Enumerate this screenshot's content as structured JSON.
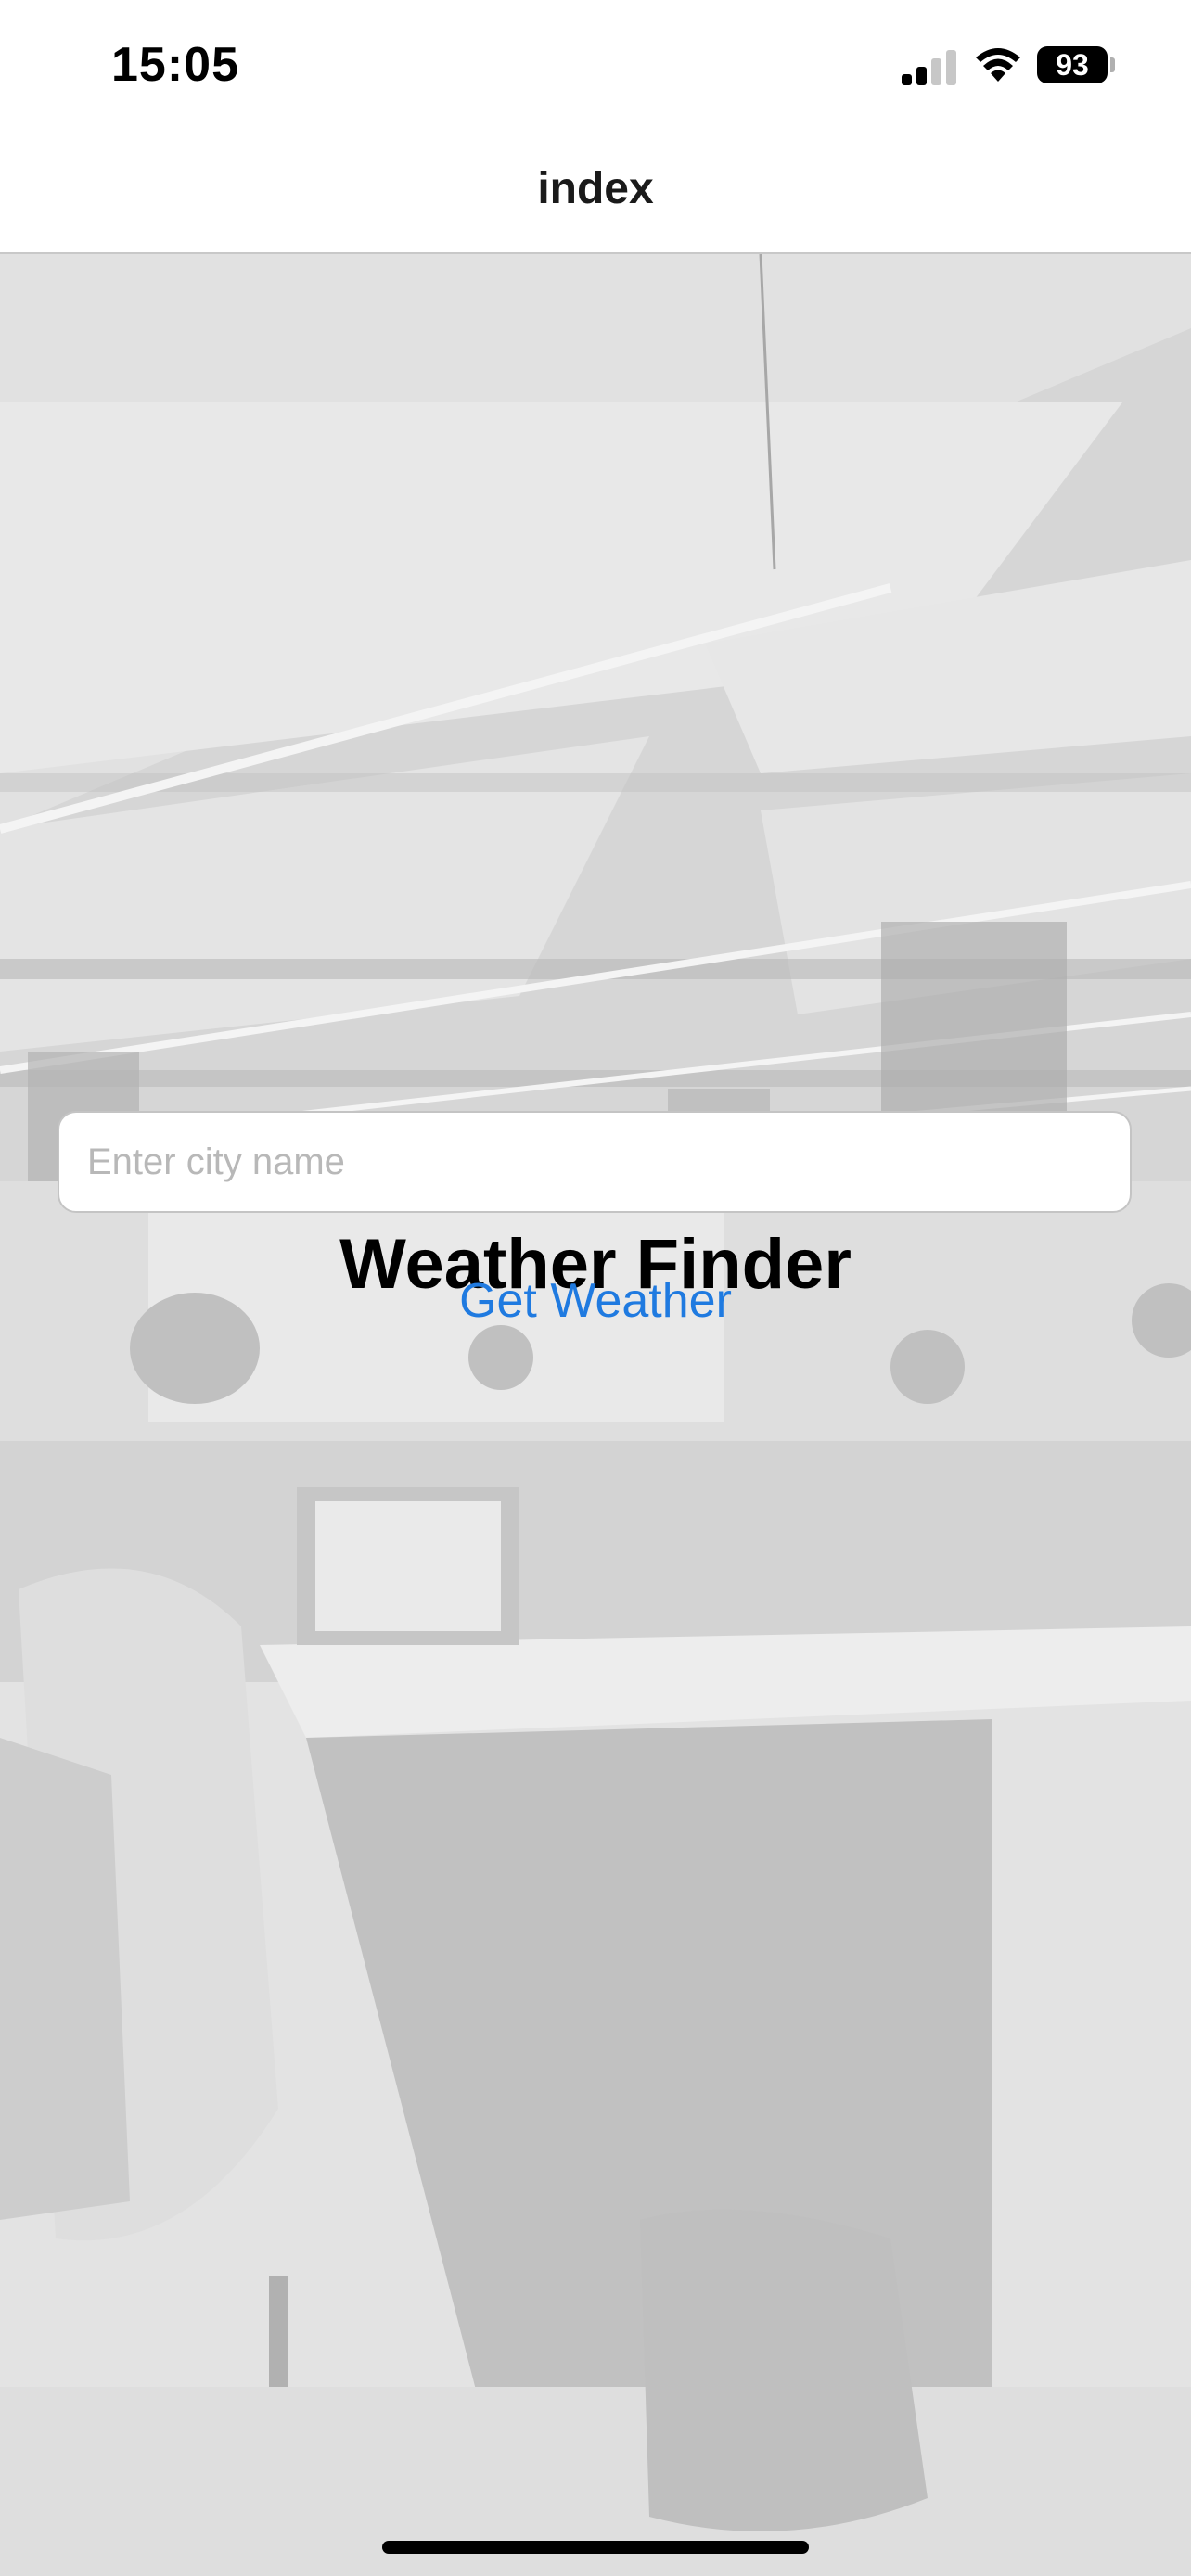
{
  "status_bar": {
    "time": "15:05",
    "battery_level": "93",
    "signal_icon": "cellular-signal-icon",
    "wifi_icon": "wifi-icon"
  },
  "nav": {
    "title": "index"
  },
  "main": {
    "title": "Weather Finder",
    "city_input": {
      "value": "",
      "placeholder": "Enter city name"
    },
    "button_label": "Get Weather"
  },
  "colors": {
    "accent": "#1f7ae0",
    "background": "#d9d9d9"
  }
}
